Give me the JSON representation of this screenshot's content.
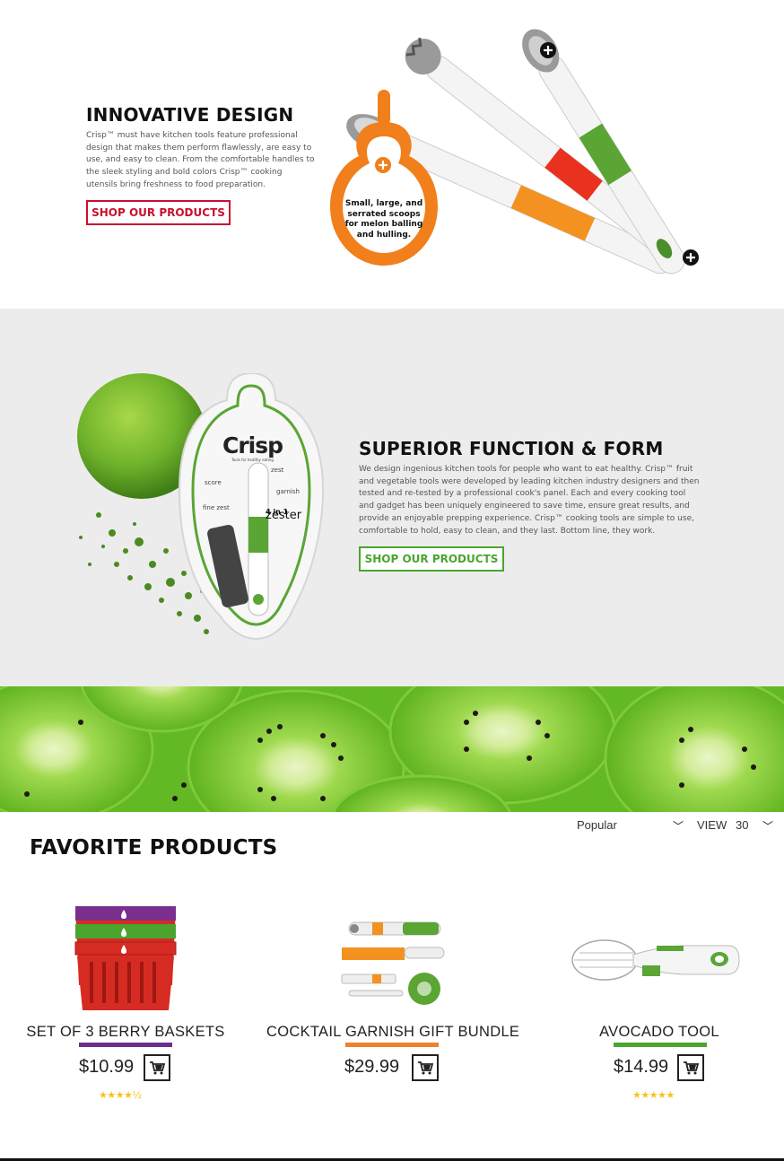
{
  "innovative": {
    "title": "INNOVATIVE DESIGN",
    "body": "Crisp™ must have kitchen tools feature professional design that makes them perform flawlessly, are easy to use, and easy to clean. From the comfortable handles to the sleek styling and bold colors Crisp™ cooking utensils bring freshness to food preparation.",
    "button": "SHOP OUR PRODUCTS",
    "callout": "Small, large, and serrated scoops for melon balling and hulling.",
    "accent": "#c8102e"
  },
  "superior": {
    "title": "SUPERIOR FUNCTION & FORM",
    "body": "We design ingenious kitchen tools for people who want to eat healthy. Crisp™ fruit and vegetable tools were developed by leading kitchen industry designers and then tested and re-tested by a professional cook's panel. Each and every cooking tool and gadget has been uniquely engineered to save time, ensure great results, and provide an enjoyable prepping experience. Crisp™ cooking tools are simple to use, comfortable to hold, easy to clean, and they last. Bottom line, they work.",
    "button": "SHOP OUR PRODUCTS",
    "accent": "#4aa52e",
    "package": {
      "brand": "Crisp",
      "tagline": "Tools for healthy eating",
      "labels": [
        "zest",
        "score",
        "garnish",
        "fine zest",
        "4 in 1",
        "zester"
      ]
    }
  },
  "products_section": {
    "title": "FAVORITE PRODUCTS",
    "sort_label": "Popular",
    "view_label": "VIEW",
    "view_value": "30",
    "items": [
      {
        "name": "SET OF 3 BERRY BASKETS",
        "price": "$10.99",
        "color": "#6d2d8b",
        "stars": "★★★★½",
        "rating": 4.5
      },
      {
        "name": "COCKTAIL GARNISH GIFT BUNDLE",
        "price": "$29.99",
        "color": "#f08027",
        "stars": "",
        "rating": 0
      },
      {
        "name": "AVOCADO TOOL",
        "price": "$14.99",
        "color": "#4aa52e",
        "stars": "★★★★★",
        "rating": 5
      }
    ]
  }
}
